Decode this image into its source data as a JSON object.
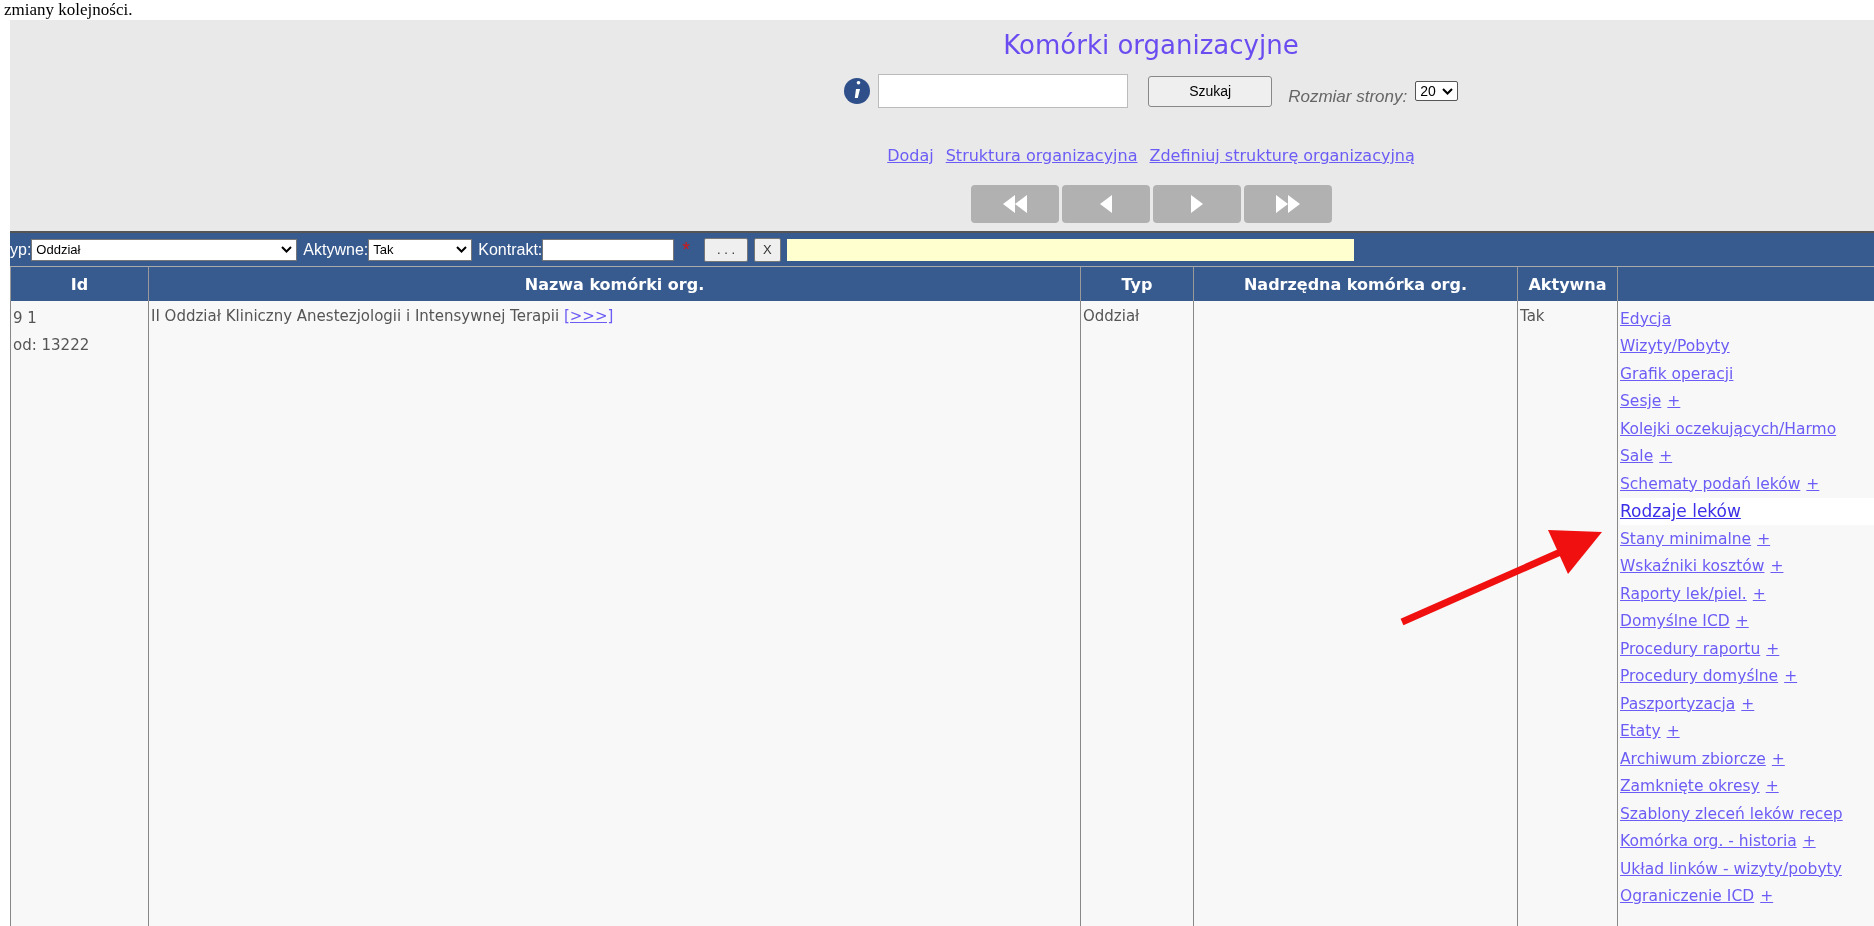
{
  "document_text": "zmiany kolejności.",
  "header": {
    "title": "Komórki organizacyjne",
    "search_button": "Szukaj",
    "page_size_label": "Rozmiar strony:",
    "page_size": "20",
    "links": [
      "Dodaj",
      "Struktura organizacyjna",
      "Zdefiniuj strukturę organizacyjną"
    ],
    "pager": [
      {
        "kind": "first"
      },
      {
        "kind": "prev"
      },
      {
        "kind": "next"
      },
      {
        "kind": "last"
      }
    ]
  },
  "filters": {
    "type_label": "yp:",
    "type_value": "Oddział",
    "active_label": "Aktywne:",
    "active_value": "Tak",
    "contract_label": "Kontrakt:",
    "required_mark": "*",
    "browse_button": ". . .",
    "clear_button": "X"
  },
  "table": {
    "columns": [
      "Id",
      "Nazwa komórki org.",
      "Typ",
      "Nadrzędna komórka org.",
      "Aktywna"
    ],
    "rows": [
      {
        "id_lines": [
          "9 1",
          "od: 13222"
        ],
        "name": "II Oddział Kliniczny Anestezjologii i Intensywnej Terapii",
        "name_link": "[>>>]",
        "type": "Oddział",
        "active": "Tak",
        "actions": [
          {
            "label": "Edycja",
            "highlighted": false
          },
          {
            "label": "Wizyty/Pobyty",
            "highlighted": false
          },
          {
            "label": "Grafik operacji",
            "highlighted": false
          },
          {
            "label": "Sesje",
            "plus": "+",
            "highlighted": false
          },
          {
            "label": "Kolejki oczekujących/Harmo",
            "highlighted": false
          },
          {
            "label": "Sale",
            "plus": "+",
            "highlighted": false
          },
          {
            "label": "Schematy podań leków",
            "plus": "+",
            "highlighted": false
          },
          {
            "label": "Rodzaje leków",
            "highlighted": true
          },
          {
            "label": "Stany minimalne",
            "plus": "+",
            "highlighted": false
          },
          {
            "label": "Wskaźniki kosztów",
            "plus": "+",
            "highlighted": false
          },
          {
            "label": "Raporty lek/piel.",
            "plus": "+",
            "highlighted": false
          },
          {
            "label": "Domyślne ICD",
            "plus": "+",
            "highlighted": false
          },
          {
            "label": "Procedury raportu",
            "plus": "+",
            "highlighted": false
          },
          {
            "label": "Procedury domyślne",
            "plus": "+",
            "highlighted": false
          },
          {
            "label": "Paszportyzacja",
            "plus": "+",
            "highlighted": false
          },
          {
            "label": "Etaty",
            "plus": "+",
            "highlighted": false
          },
          {
            "label": "Archiwum zbiorcze",
            "plus": "+",
            "highlighted": false
          },
          {
            "label": "Zamknięte okresy",
            "plus": "+",
            "highlighted": false
          },
          {
            "label": "Szablony zleceń leków recep",
            "highlighted": false
          },
          {
            "label": "Komórka org. - historia",
            "plus": "+",
            "highlighted": false
          },
          {
            "label": "Układ linków - wizyty/pobyty",
            "highlighted": false
          },
          {
            "label": "Ograniczenie ICD",
            "plus": "+",
            "highlighted": false
          }
        ]
      }
    ]
  },
  "annotation": {
    "kind": "arrow"
  }
}
